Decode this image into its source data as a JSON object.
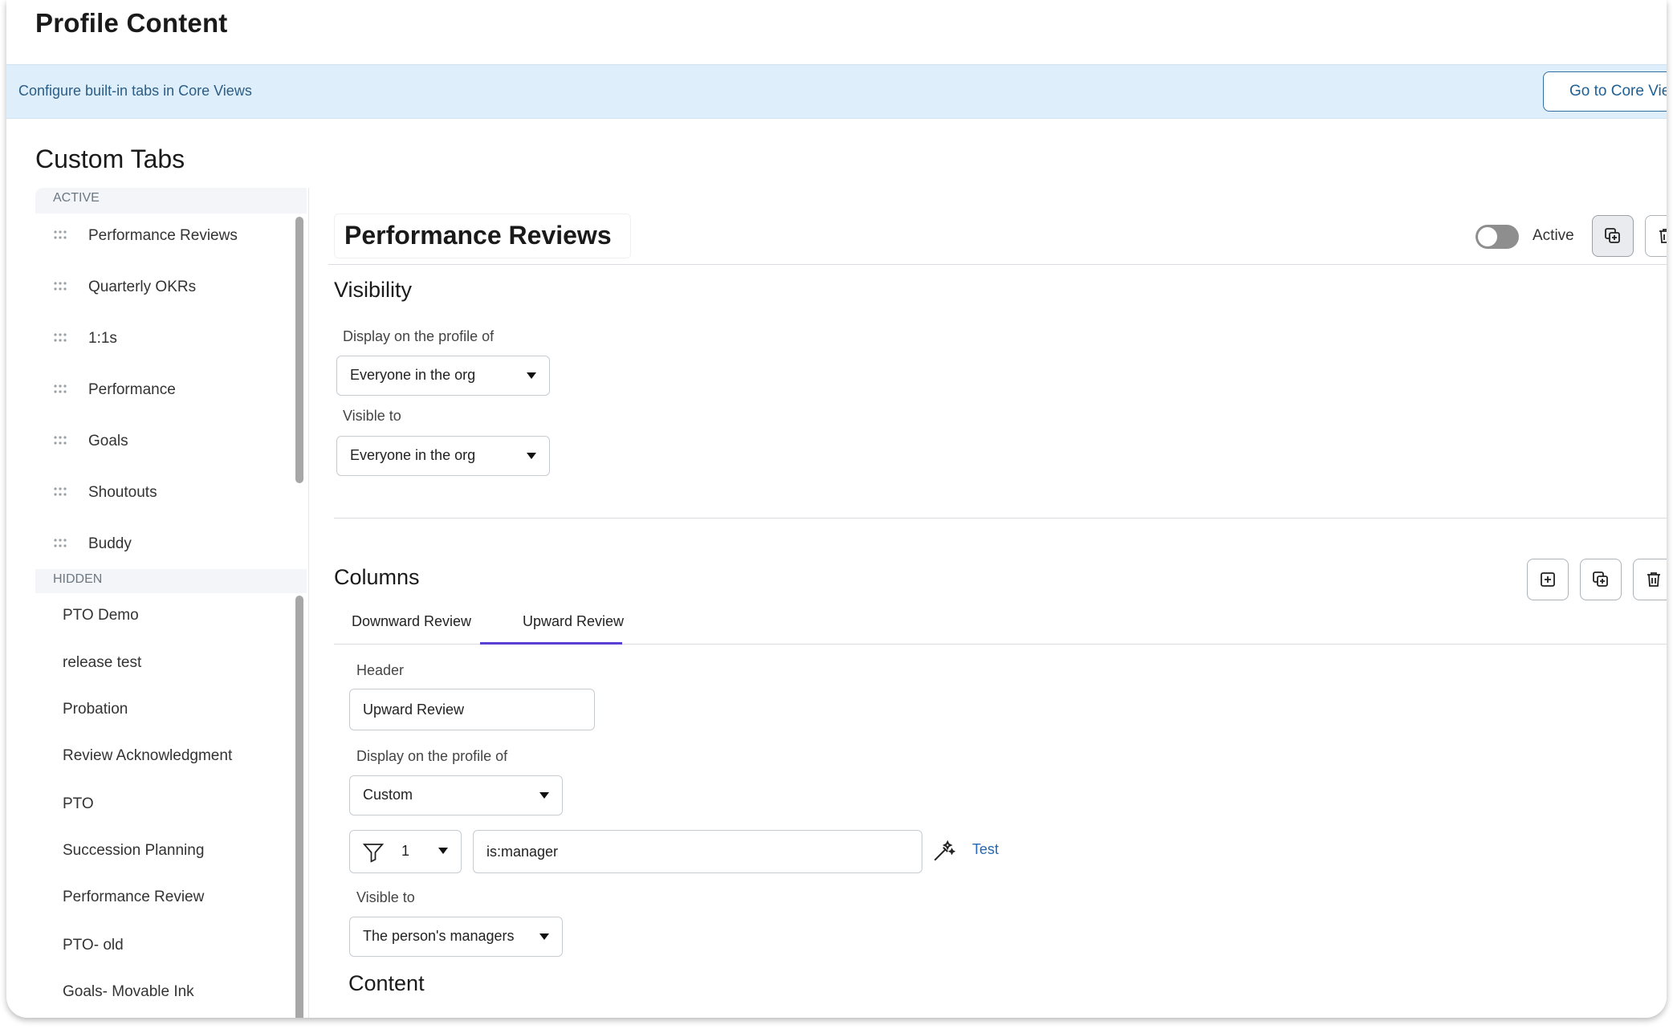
{
  "page": {
    "title": "Profile Content"
  },
  "banner": {
    "text": "Configure built-in tabs in Core Views",
    "button_label": "Go to Core Views"
  },
  "custom_tabs": {
    "title": "Custom Tabs",
    "active_header": "ACTIVE",
    "active_items": [
      {
        "label": "Performance Reviews"
      },
      {
        "label": "Quarterly OKRs"
      },
      {
        "label": "1:1s"
      },
      {
        "label": "Performance"
      },
      {
        "label": "Goals"
      },
      {
        "label": "Shoutouts"
      },
      {
        "label": "Buddy"
      }
    ],
    "hidden_header": "HIDDEN",
    "hidden_items": [
      {
        "label": "PTO Demo"
      },
      {
        "label": "release test"
      },
      {
        "label": "Probation"
      },
      {
        "label": "Review Acknowledgment"
      },
      {
        "label": "PTO"
      },
      {
        "label": "Succession Planning"
      },
      {
        "label": "Performance Review"
      },
      {
        "label": "PTO- old"
      },
      {
        "label": "Goals- Movable Ink"
      }
    ]
  },
  "detail": {
    "tab_name": "Performance Reviews",
    "active_label": "Active",
    "active": false,
    "visibility": {
      "title": "Visibility",
      "display_label": "Display on the profile of",
      "display_value": "Everyone in the org",
      "visible_label": "Visible to",
      "visible_value": "Everyone in the org"
    },
    "columns": {
      "title": "Columns",
      "tabs": [
        {
          "label": "Downward Review",
          "selected": false
        },
        {
          "label": "Upward Review",
          "selected": true
        }
      ],
      "header_label": "Header",
      "header_value": "Upward Review",
      "display_label": "Display on the profile of",
      "display_value": "Custom",
      "filter_count": "1",
      "filter_query": "is:manager",
      "test_label": "Test",
      "visible_label": "Visible to",
      "visible_value": "The person's managers"
    },
    "content_title": "Content"
  },
  "colors": {
    "accent": "#5a3fd4",
    "banner_bg": "#deeefa",
    "link": "#2768b0"
  }
}
